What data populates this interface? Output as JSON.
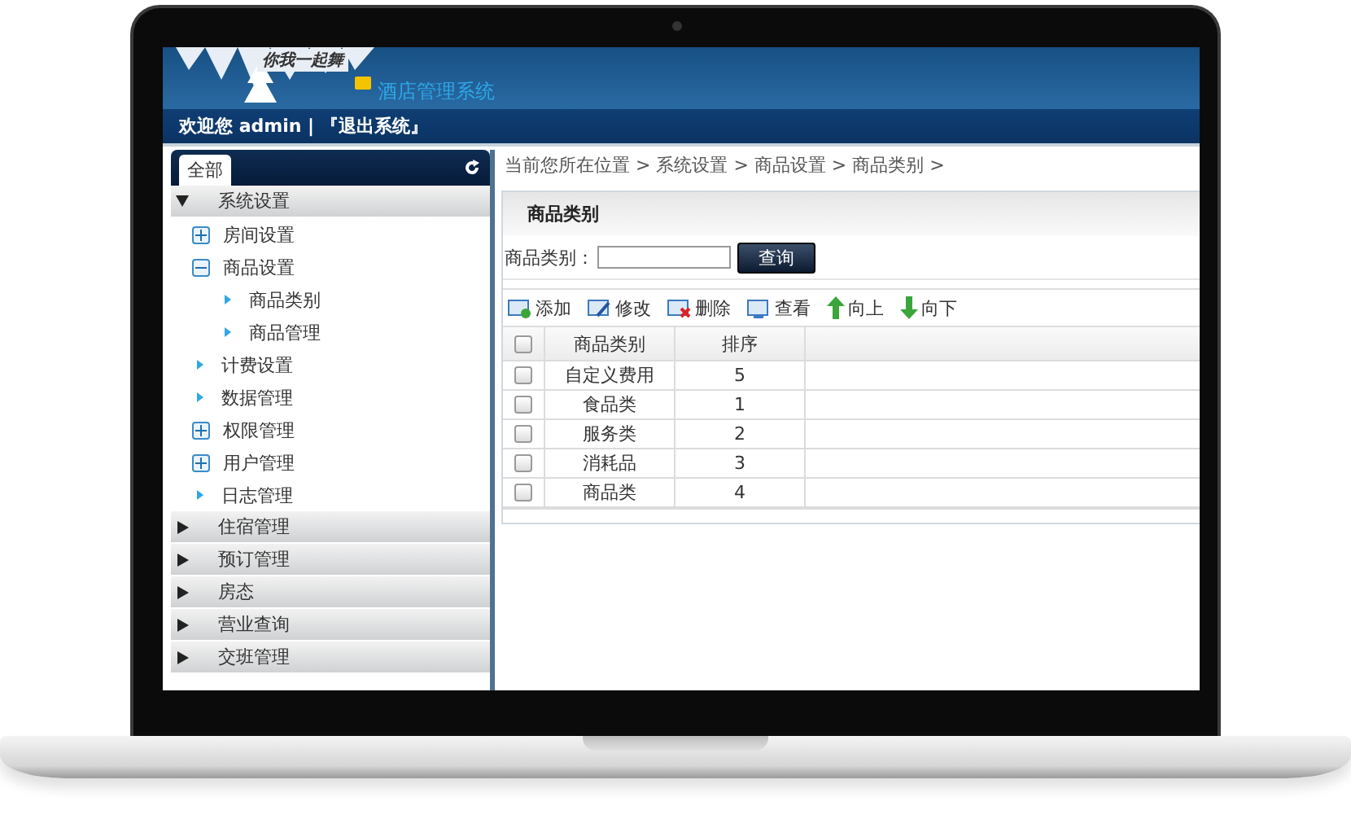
{
  "header": {
    "logo_text": "你我一起舞",
    "title": "酒店管理系统"
  },
  "userbar": {
    "welcome": "欢迎您 admin |",
    "logout": "『退出系统』"
  },
  "sidebar": {
    "tab": {
      "label": "全部",
      "selected": true
    },
    "groups": [
      {
        "label": "系统设置",
        "expanded": true,
        "children": [
          {
            "label": "房间设置",
            "kind": "folder",
            "expanded": false
          },
          {
            "label": "商品设置",
            "kind": "folder",
            "expanded": true,
            "children": [
              {
                "label": "商品类别",
                "kind": "leaf"
              },
              {
                "label": "商品管理",
                "kind": "leaf"
              }
            ]
          },
          {
            "label": "计费设置",
            "kind": "leaf"
          },
          {
            "label": "数据管理",
            "kind": "leaf"
          },
          {
            "label": "权限管理",
            "kind": "folder",
            "expanded": false
          },
          {
            "label": "用户管理",
            "kind": "folder",
            "expanded": false
          },
          {
            "label": "日志管理",
            "kind": "leaf"
          }
        ]
      },
      {
        "label": "住宿管理",
        "expanded": false
      },
      {
        "label": "预订管理",
        "expanded": false
      },
      {
        "label": "房态",
        "expanded": false
      },
      {
        "label": "营业查询",
        "expanded": false
      },
      {
        "label": "交班管理",
        "expanded": false
      }
    ]
  },
  "breadcrumb": "当前您所在位置 > 系统设置 > 商品设置 > 商品类别 >",
  "panel": {
    "title": "商品类别",
    "search_label": "商品类别：",
    "search_button": "查询",
    "toolbar": [
      {
        "label": "添加",
        "kind": "add"
      },
      {
        "label": "修改",
        "kind": "edit"
      },
      {
        "label": "删除",
        "kind": "delete"
      },
      {
        "label": "查看",
        "kind": "view"
      },
      {
        "label": "向上",
        "kind": "up"
      },
      {
        "label": "向下",
        "kind": "down"
      }
    ],
    "table": {
      "all_checked": false,
      "columns": [
        "商品类别",
        "排序"
      ],
      "rows": [
        {
          "name": "自定义费用",
          "order": "5",
          "checked": false
        },
        {
          "name": "食品类",
          "order": "1",
          "checked": false
        },
        {
          "name": "服务类",
          "order": "2",
          "checked": false
        },
        {
          "name": "消耗品",
          "order": "3",
          "checked": false
        },
        {
          "name": "商品类",
          "order": "4",
          "checked": false
        }
      ]
    }
  }
}
